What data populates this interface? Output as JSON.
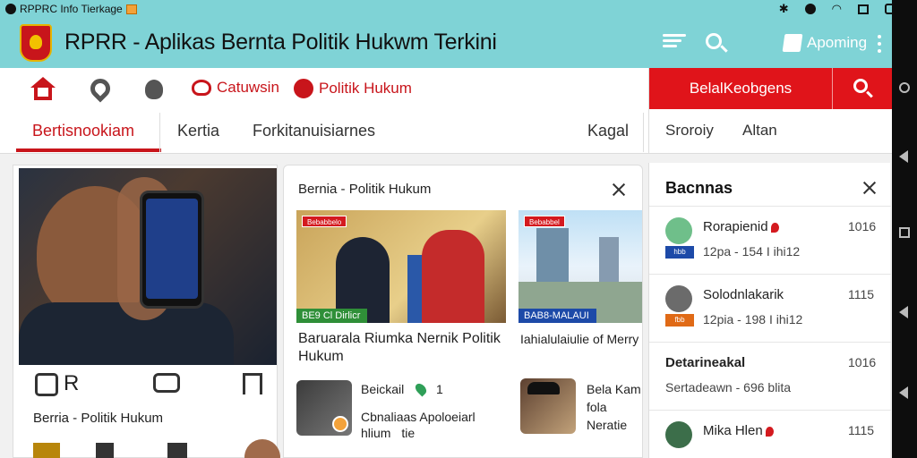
{
  "status_bar": {
    "app_name": "RPPRC Info Tierkage",
    "battery": "=="
  },
  "app_bar": {
    "title": "RPRR - Aplikas Bernta Politik Hukwm Terkini",
    "report_label": "Apoming"
  },
  "nav": {
    "chips": [
      "Catuwsin",
      "Politik Hukum"
    ],
    "tabs": [
      "Bertisnookiam",
      "Kertia",
      "Forkitanuisiarnes",
      "Kagal"
    ],
    "right_button": "BelalKeobgens",
    "right_tabs": [
      "Sroroiy",
      "Altan"
    ]
  },
  "left_card": {
    "icon_letter": "R",
    "caption": "Berria - Politik Hukum"
  },
  "mid_card": {
    "title": "Bernia - Politik Hukum",
    "thumb1_badge": "Bebabbelo",
    "thumb1_label": "BE9 Cl Dirlicr",
    "thumb2_badge": "Bebabbel",
    "thumb2_label": "BAB8-MALAUI",
    "headline1": "Baruarala Riumka Nernik Politik Hukum",
    "headline2": "Iahialulaiulie of Merry",
    "mini1_title": "Beickail",
    "mini1_count": "1",
    "mini1_body": "Cbnaliaas Apoloeiarl hlium",
    "mini1_extra": "tie",
    "mini2_title": "Bela Kam fola Neratie"
  },
  "right_card": {
    "title": "Bacnnas",
    "items": [
      {
        "name": "Rorapienid",
        "num": "1016",
        "tag": "hbb",
        "meta": "12pa - 154 I ihi12"
      },
      {
        "name": "Solodnlakarik",
        "num": "1115",
        "tag": "fbb",
        "meta": "12pia - 198 I ihi12"
      },
      {
        "name": "Detarineakal",
        "num": "1016",
        "tag": "",
        "meta": "Sertadeawn - 696 blita"
      },
      {
        "name": "Mika Hlen",
        "num": "1115",
        "tag": "",
        "meta": ""
      }
    ]
  },
  "colors": {
    "accent_red": "#e0141a",
    "teal_bar": "#7fd3d6"
  }
}
